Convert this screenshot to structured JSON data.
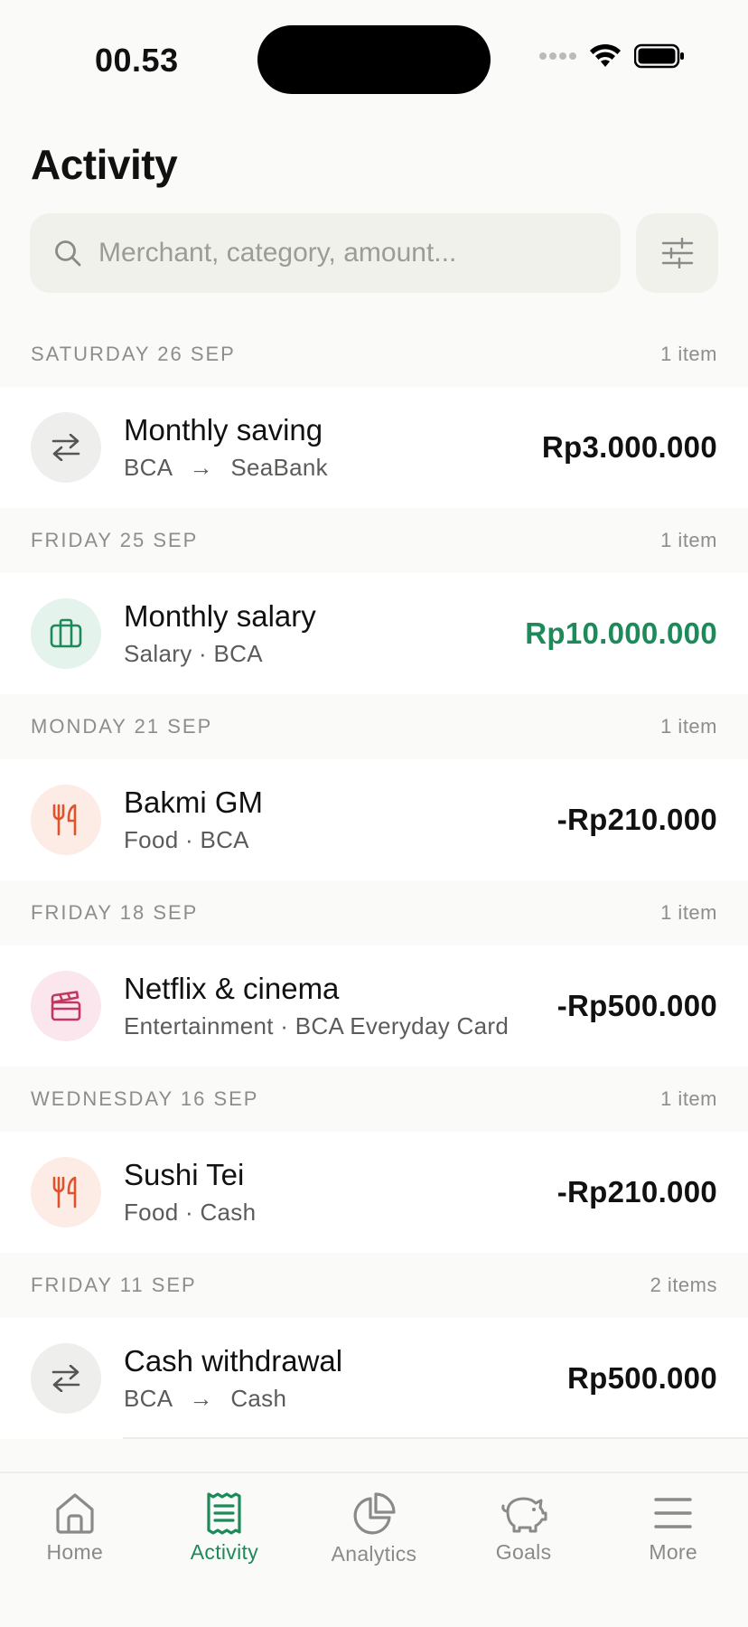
{
  "status_bar": {
    "time": "00.53"
  },
  "header": {
    "title": "Activity"
  },
  "search": {
    "placeholder": "Merchant, category, amount..."
  },
  "colors": {
    "accent": "#1e8a5a",
    "income": "#1e8a5a",
    "food": "#e0522b",
    "entertainment": "#c2365f"
  },
  "groups": [
    {
      "date": "SATURDAY 26 SEP",
      "count": "1 item",
      "items": [
        {
          "title": "Monthly saving",
          "from": "BCA",
          "to": "SeaBank",
          "amount": "Rp3.000.000",
          "icon": "transfer-icon"
        }
      ]
    },
    {
      "date": "FRIDAY 25 SEP",
      "count": "1 item",
      "items": [
        {
          "title": "Monthly salary",
          "subtitle": "Salary · BCA",
          "amount": "Rp10.000.000",
          "icon": "briefcase-icon"
        }
      ]
    },
    {
      "date": "MONDAY 21 SEP",
      "count": "1 item",
      "items": [
        {
          "title": "Bakmi GM",
          "subtitle": "Food · BCA",
          "amount": "-Rp210.000",
          "icon": "fork-knife-icon"
        }
      ]
    },
    {
      "date": "FRIDAY 18 SEP",
      "count": "1 item",
      "items": [
        {
          "title": "Netflix & cinema",
          "subtitle": "Entertainment · BCA Everyday Card",
          "amount": "-Rp500.000",
          "icon": "clapperboard-icon"
        }
      ]
    },
    {
      "date": "WEDNESDAY 16 SEP",
      "count": "1 item",
      "items": [
        {
          "title": "Sushi Tei",
          "subtitle": "Food · Cash",
          "amount": "-Rp210.000",
          "icon": "fork-knife-icon"
        }
      ]
    },
    {
      "date": "FRIDAY 11 SEP",
      "count": "2 items",
      "items": [
        {
          "title": "Cash withdrawal",
          "from": "BCA",
          "to": "Cash",
          "amount": "Rp500.000",
          "icon": "transfer-icon"
        }
      ]
    }
  ],
  "tabs": [
    {
      "label": "Home",
      "icon": "home-icon"
    },
    {
      "label": "Activity",
      "icon": "receipt-icon",
      "active": true
    },
    {
      "label": "Analytics",
      "icon": "pie-chart-icon"
    },
    {
      "label": "Goals",
      "icon": "piggy-bank-icon"
    },
    {
      "label": "More",
      "icon": "menu-icon"
    }
  ]
}
